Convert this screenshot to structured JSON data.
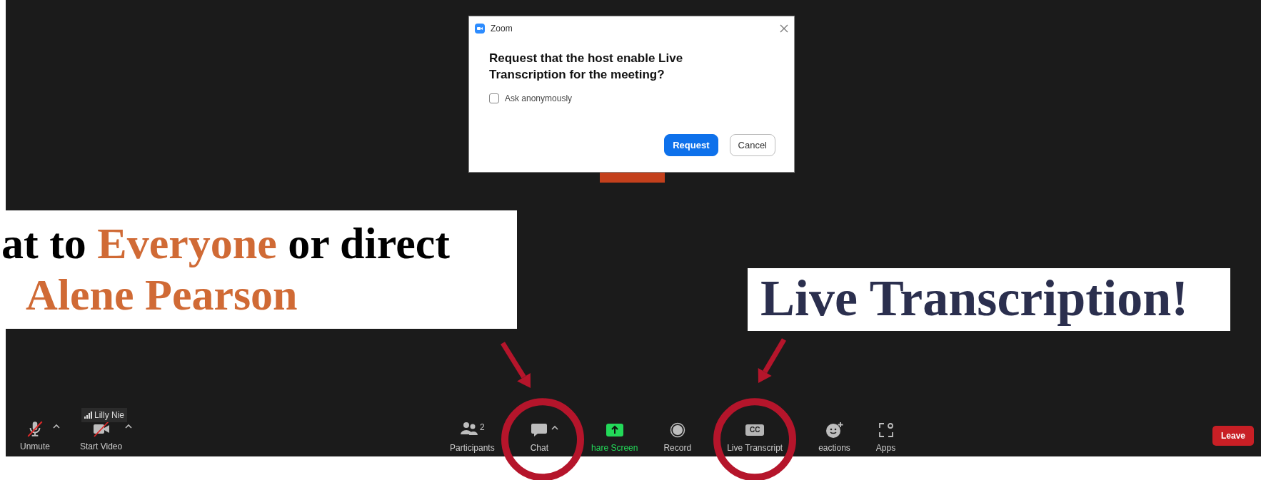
{
  "dialog": {
    "title": "Zoom",
    "message": "Request that the host enable Live Transcription for the meeting?",
    "checkbox": {
      "label": "Ask anonymously",
      "checked": false
    },
    "buttons": [
      {
        "label": "Request",
        "primary": true
      },
      {
        "label": "Cancel",
        "primary": false
      }
    ]
  },
  "callouts": [
    {
      "kind": "chat",
      "lines": [
        [
          {
            "text": "at to ",
            "highlight": false
          },
          {
            "text": "Everyone",
            "highlight": true
          },
          {
            "text": " or direct",
            "highlight": false
          }
        ],
        [
          {
            "text": "Alene Pearson",
            "highlight": true
          }
        ]
      ]
    },
    {
      "kind": "transcript",
      "lines": [
        [
          {
            "text": "Live Transcription!",
            "highlight": false
          }
        ]
      ]
    }
  ],
  "name_tag": {
    "name": "Lilly Nie"
  },
  "toolbar": {
    "left": [
      {
        "kind": "mic",
        "label": "Unmute",
        "off": true,
        "menu": true
      },
      {
        "kind": "video",
        "label": "Start Video",
        "off": true,
        "menu": true
      }
    ],
    "center": [
      {
        "kind": "participants",
        "label": "Participants",
        "count": "2",
        "circled": false
      },
      {
        "kind": "chat",
        "label": "Chat",
        "menu": true,
        "circled": true
      },
      {
        "kind": "share",
        "label": "hare Screen",
        "circled": false
      },
      {
        "kind": "record",
        "label": "Record",
        "circled": false
      },
      {
        "kind": "transcript",
        "label": "Live Transcript",
        "badge": "CC",
        "circled": true
      },
      {
        "kind": "reactions",
        "label": "eactions",
        "circled": false
      },
      {
        "kind": "apps",
        "label": "Apps",
        "circled": false
      }
    ],
    "leave": {
      "label": "Leave"
    }
  }
}
